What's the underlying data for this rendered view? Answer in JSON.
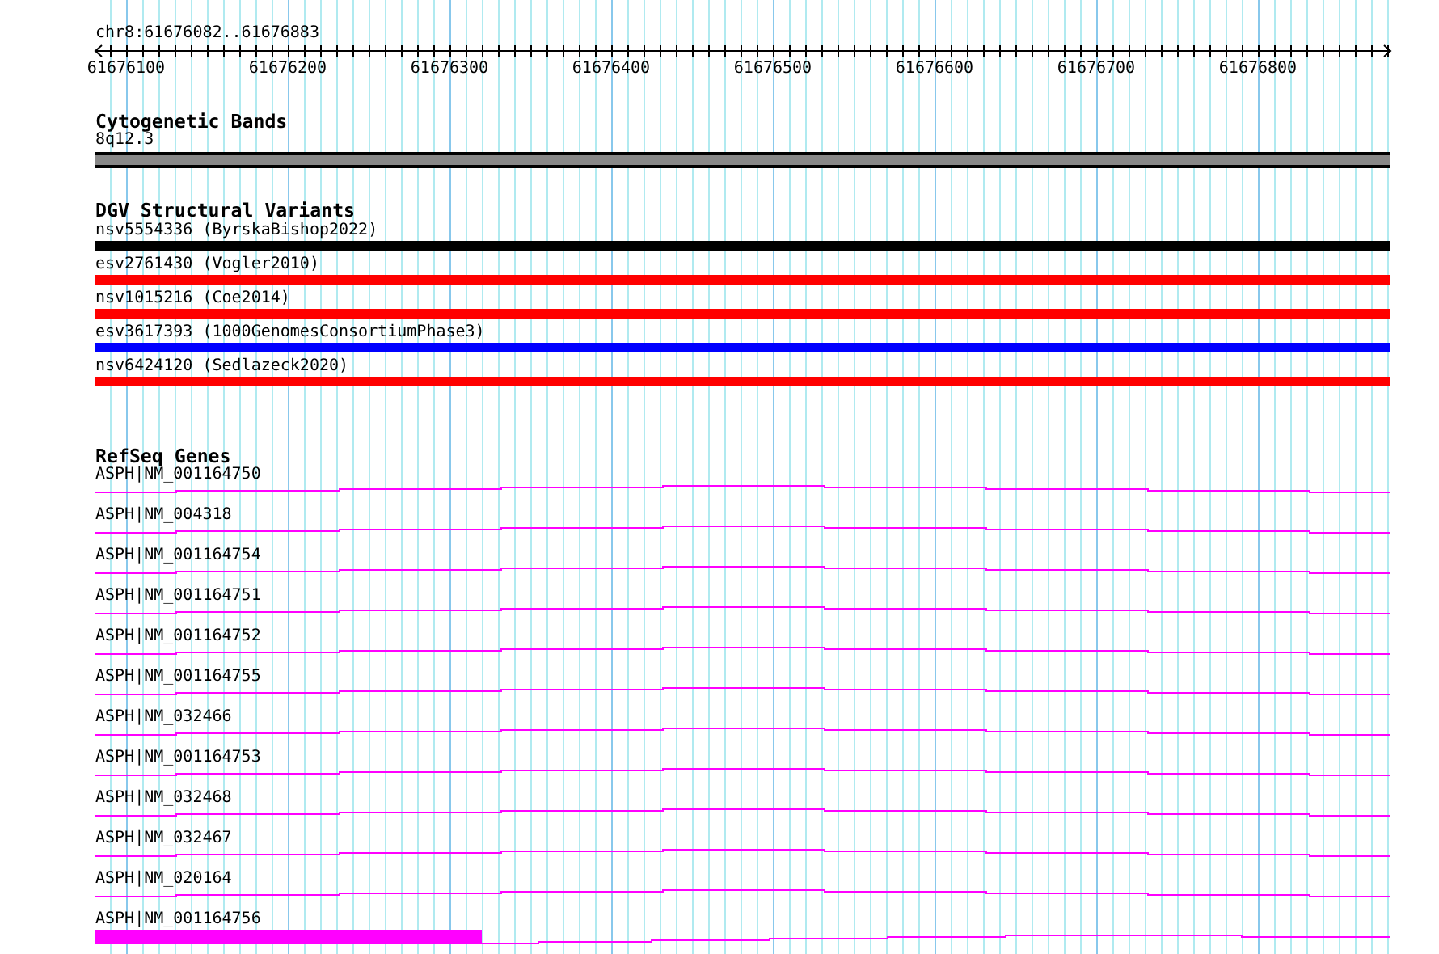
{
  "position": "chr8:61676082..61676883",
  "ruler": {
    "tick_labels": [
      "61676100",
      "61676200",
      "61676300",
      "61676400",
      "61676500",
      "61676600",
      "61676700",
      "61676800"
    ]
  },
  "tracks": [
    {
      "title": "Cytogenetic Bands",
      "kind": "band",
      "features": [
        {
          "label": "8q12.3"
        }
      ]
    },
    {
      "title": "DGV Structural Variants",
      "kind": "variant",
      "features": [
        {
          "label": "nsv5554336 (ByrskaBishop2022)",
          "color": "#000000"
        },
        {
          "label": "esv2761430 (Vogler2010)",
          "color": "#ff0000"
        },
        {
          "label": "nsv1015216 (Coe2014)",
          "color": "#ff0000"
        },
        {
          "label": "esv3617393 (1000GenomesConsortiumPhase3)",
          "color": "#0000ff"
        },
        {
          "label": "nsv6424120 (Sedlazeck2020)",
          "color": "#ff0000"
        }
      ]
    },
    {
      "title": "RefSeq Genes",
      "kind": "gene",
      "features": [
        {
          "label": "ASPH|NM_001164750",
          "exon": false
        },
        {
          "label": "ASPH|NM_004318",
          "exon": false
        },
        {
          "label": "ASPH|NM_001164754",
          "exon": false
        },
        {
          "label": "ASPH|NM_001164751",
          "exon": false
        },
        {
          "label": "ASPH|NM_001164752",
          "exon": false
        },
        {
          "label": "ASPH|NM_001164755",
          "exon": false
        },
        {
          "label": "ASPH|NM_032466",
          "exon": false
        },
        {
          "label": "ASPH|NM_001164753",
          "exon": false
        },
        {
          "label": "ASPH|NM_032468",
          "exon": false
        },
        {
          "label": "ASPH|NM_032467",
          "exon": false
        },
        {
          "label": "ASPH|NM_020164",
          "exon": false
        },
        {
          "label": "ASPH|NM_001164756",
          "exon": true
        }
      ]
    }
  ]
}
